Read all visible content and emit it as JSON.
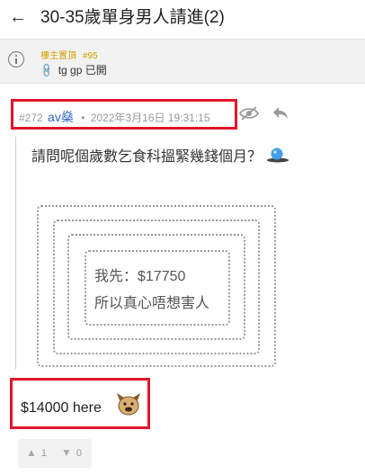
{
  "header": {
    "back_icon": "back-arrow-icon",
    "title": "30-35歲單身男人請進(2)"
  },
  "pinned": {
    "label": "樓主置頂",
    "post_number": "#95",
    "text": "tg gp 已開",
    "icon": "info-icon",
    "label_color": "#d4a000"
  },
  "post": {
    "number": "#272",
    "username": "av燊",
    "separator": "•",
    "timestamp": "2022年3月16日 19:31:15",
    "username_color": "#2f64c8"
  },
  "quote": {
    "question": "請問呢個歲數乞食科搵緊幾錢個月？",
    "inner_line1": "我先：$17750",
    "inner_line2": "所以真心唔想害人"
  },
  "reply": {
    "text": "$14000 here"
  },
  "votes": {
    "up_count": "1",
    "down_count": "0"
  },
  "colors": {
    "highlight": "#e0172b"
  }
}
